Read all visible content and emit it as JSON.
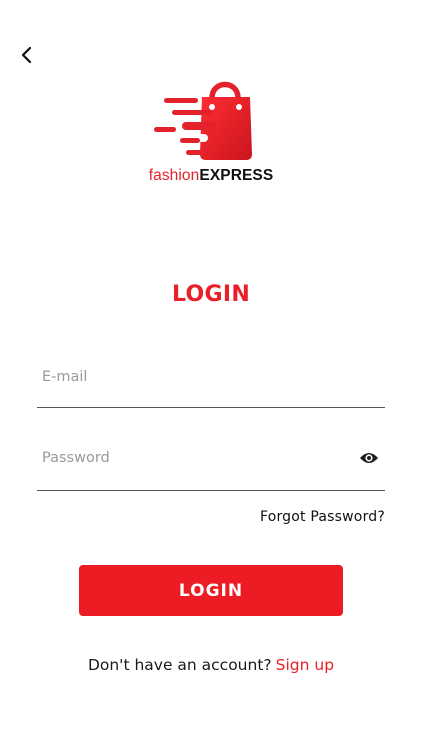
{
  "header": {
    "back_icon": "chevron-left-icon"
  },
  "logo": {
    "icon": "shopping-bag-speed-icon",
    "word_light": "fashion",
    "word_bold": "EXPRESS"
  },
  "title": "LOGIN",
  "form": {
    "email_placeholder": "E-mail",
    "email_value": "",
    "password_placeholder": "Password",
    "password_value": "",
    "eye_icon": "eye-icon",
    "forgot_label": "Forgot Password?",
    "submit_label": "LOGIN"
  },
  "footer": {
    "prompt": "Don't have an account?",
    "signup_label": "Sign up"
  },
  "colors": {
    "accent": "#ed1c24",
    "text": "#1a1a1a",
    "placeholder": "#9a9a9a"
  }
}
